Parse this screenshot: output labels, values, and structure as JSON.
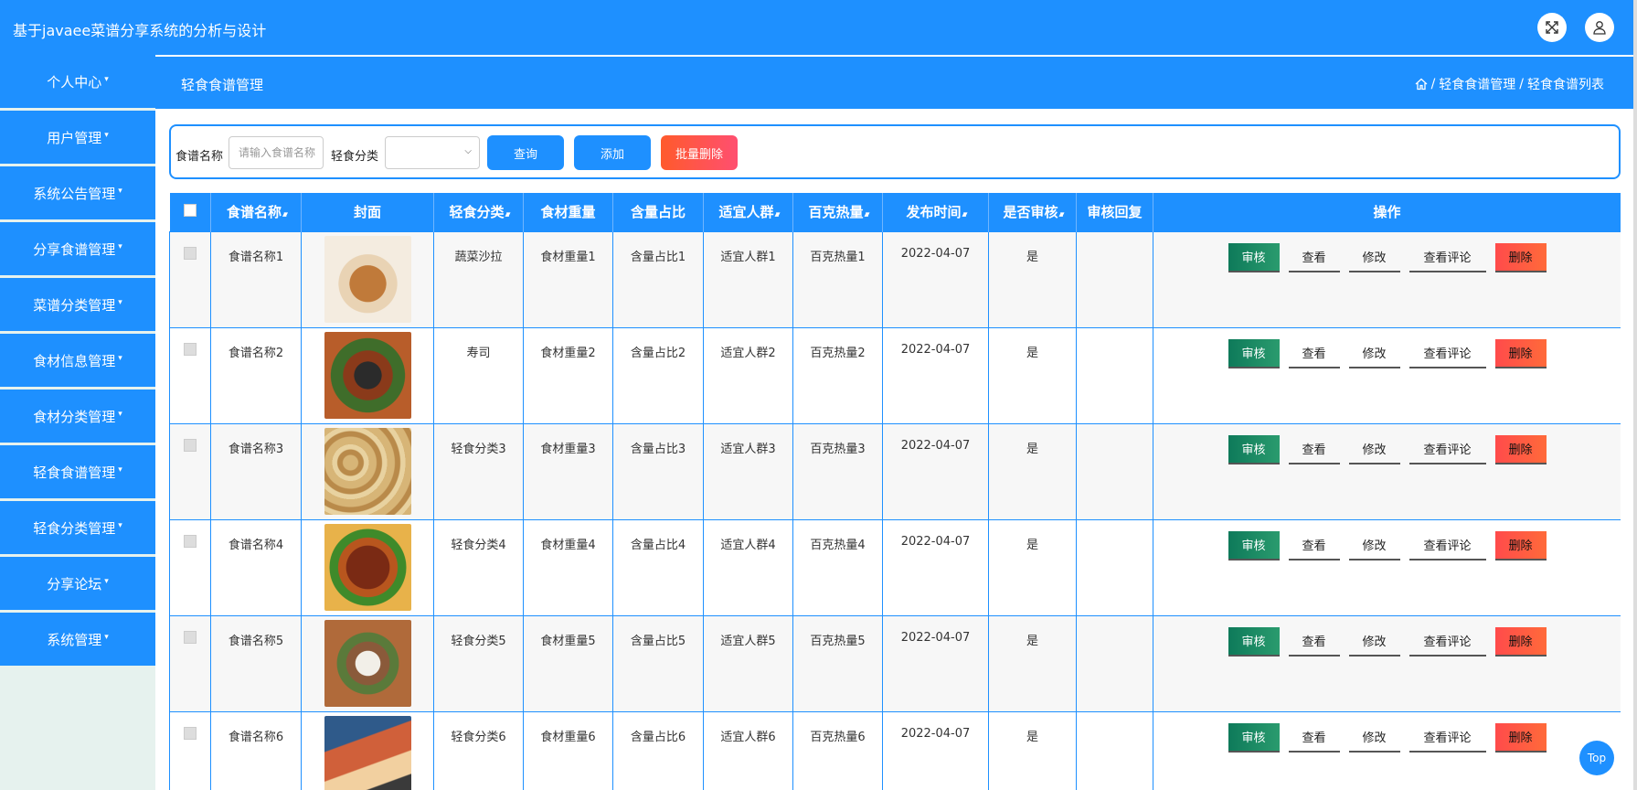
{
  "app": {
    "title": "基于javaee菜谱分享系统的分析与设计"
  },
  "header": {
    "fullscreen_icon": "fullscreen-icon",
    "user_icon": "user-icon"
  },
  "sidebar": {
    "items": [
      {
        "label": "个人中心"
      },
      {
        "label": "用户管理"
      },
      {
        "label": "系统公告管理"
      },
      {
        "label": "分享食谱管理"
      },
      {
        "label": "菜谱分类管理"
      },
      {
        "label": "食材信息管理"
      },
      {
        "label": "食材分类管理"
      },
      {
        "label": "轻食食谱管理"
      },
      {
        "label": "轻食分类管理"
      },
      {
        "label": "分享论坛"
      },
      {
        "label": "系统管理"
      }
    ]
  },
  "page": {
    "title": "轻食食谱管理",
    "breadcrumb": [
      "轻食食谱管理",
      "轻食食谱列表"
    ]
  },
  "search": {
    "name_label": "食谱名称",
    "name_placeholder": "请输入食谱名称",
    "category_label": "轻食分类",
    "category_value": "",
    "query_label": "查询",
    "add_label": "添加",
    "batch_delete_label": "批量删除"
  },
  "table": {
    "columns": [
      "食谱名称",
      "封面",
      "轻食分类",
      "食材重量",
      "含量占比",
      "适宜人群",
      "百克热量",
      "发布时间",
      "是否审核",
      "审核回复",
      "操作"
    ],
    "actions": {
      "audit": "审核",
      "view": "查看",
      "edit": "修改",
      "comments": "查看评论",
      "delete": "删除"
    },
    "rows": [
      {
        "name": "食谱名称1",
        "category": "蔬菜沙拉",
        "weight": "食材重量1",
        "ratio": "含量占比1",
        "crowd": "适宜人群1",
        "calories": "百克热量1",
        "date": "2022-04-07",
        "audited": "是",
        "reply": ""
      },
      {
        "name": "食谱名称2",
        "category": "寿司",
        "weight": "食材重量2",
        "ratio": "含量占比2",
        "crowd": "适宜人群2",
        "calories": "百克热量2",
        "date": "2022-04-07",
        "audited": "是",
        "reply": ""
      },
      {
        "name": "食谱名称3",
        "category": "轻食分类3",
        "weight": "食材重量3",
        "ratio": "含量占比3",
        "crowd": "适宜人群3",
        "calories": "百克热量3",
        "date": "2022-04-07",
        "audited": "是",
        "reply": ""
      },
      {
        "name": "食谱名称4",
        "category": "轻食分类4",
        "weight": "食材重量4",
        "ratio": "含量占比4",
        "crowd": "适宜人群4",
        "calories": "百克热量4",
        "date": "2022-04-07",
        "audited": "是",
        "reply": ""
      },
      {
        "name": "食谱名称5",
        "category": "轻食分类5",
        "weight": "食材重量5",
        "ratio": "含量占比5",
        "crowd": "适宜人群5",
        "calories": "百克热量5",
        "date": "2022-04-07",
        "audited": "是",
        "reply": ""
      },
      {
        "name": "食谱名称6",
        "category": "轻食分类6",
        "weight": "食材重量6",
        "ratio": "含量占比6",
        "crowd": "适宜人群6",
        "calories": "百克热量6",
        "date": "2022-04-07",
        "audited": "是",
        "reply": ""
      }
    ]
  },
  "back_to_top": "Top",
  "colors": {
    "primary": "#1e90ff",
    "audit": "#0e7a5a",
    "delete": "#ff4b4b"
  }
}
